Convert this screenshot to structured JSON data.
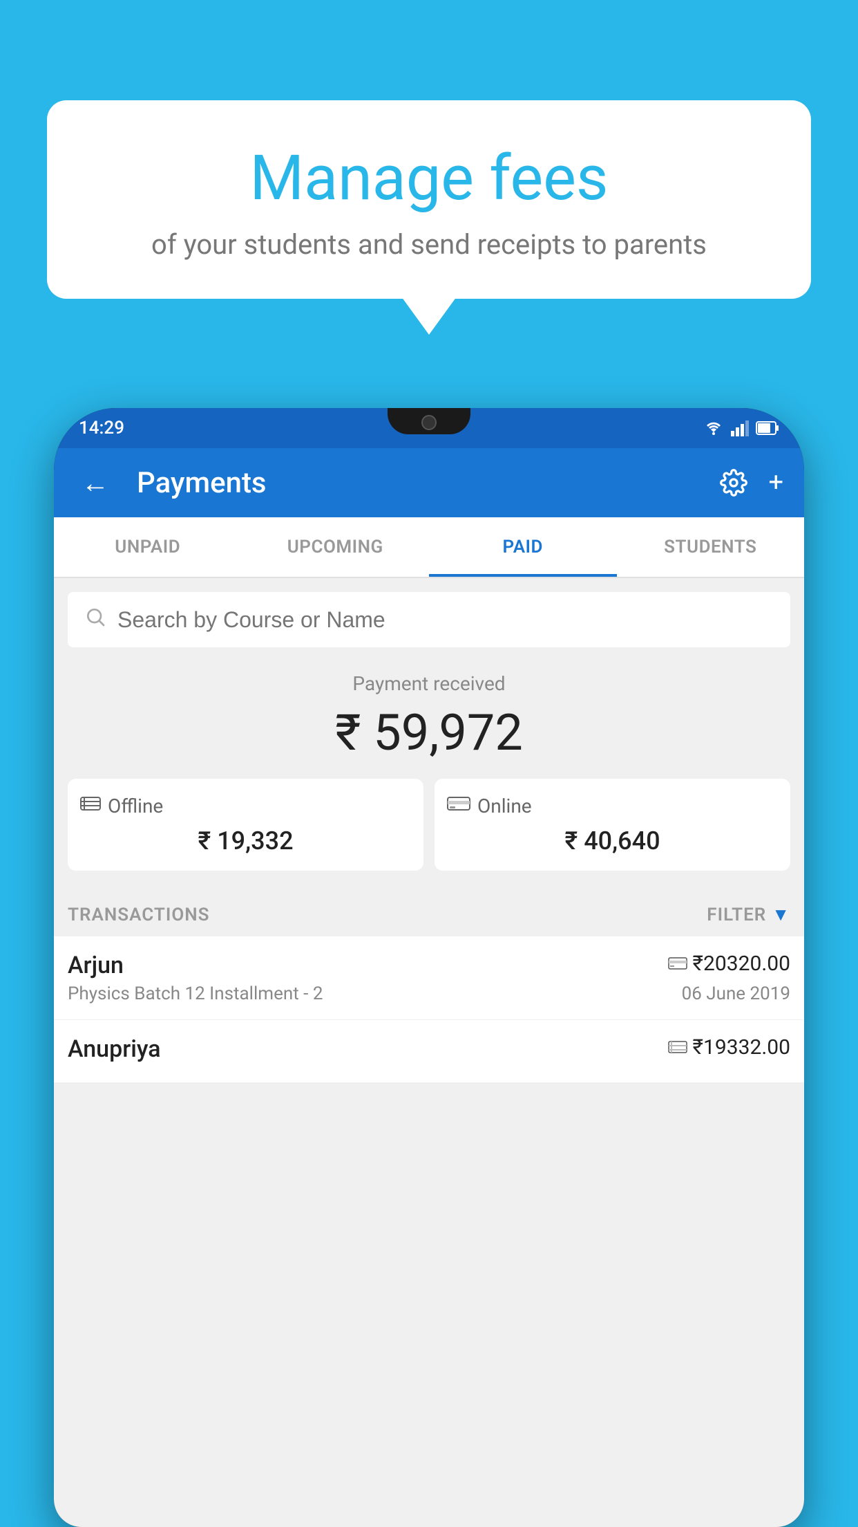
{
  "background_color": "#29b6e8",
  "speech_bubble": {
    "title": "Manage fees",
    "subtitle": "of your students and send receipts to parents"
  },
  "status_bar": {
    "time": "14:29",
    "icons": [
      "wifi",
      "signal",
      "battery"
    ]
  },
  "app_bar": {
    "title": "Payments",
    "back_icon": "←",
    "settings_icon": "⚙",
    "add_icon": "+"
  },
  "tabs": [
    {
      "label": "UNPAID",
      "active": false
    },
    {
      "label": "UPCOMING",
      "active": false
    },
    {
      "label": "PAID",
      "active": true
    },
    {
      "label": "STUDENTS",
      "active": false
    }
  ],
  "search": {
    "placeholder": "Search by Course or Name"
  },
  "payment_summary": {
    "label": "Payment received",
    "total": "₹ 59,972",
    "offline": {
      "label": "Offline",
      "amount": "₹ 19,332"
    },
    "online": {
      "label": "Online",
      "amount": "₹ 40,640"
    }
  },
  "transactions": {
    "label": "TRANSACTIONS",
    "filter_label": "FILTER",
    "items": [
      {
        "name": "Arjun",
        "amount": "₹20320.00",
        "course": "Physics Batch 12 Installment - 2",
        "date": "06 June 2019",
        "payment_type": "online"
      },
      {
        "name": "Anupriya",
        "amount": "₹19332.00",
        "course": "",
        "date": "",
        "payment_type": "offline"
      }
    ]
  }
}
